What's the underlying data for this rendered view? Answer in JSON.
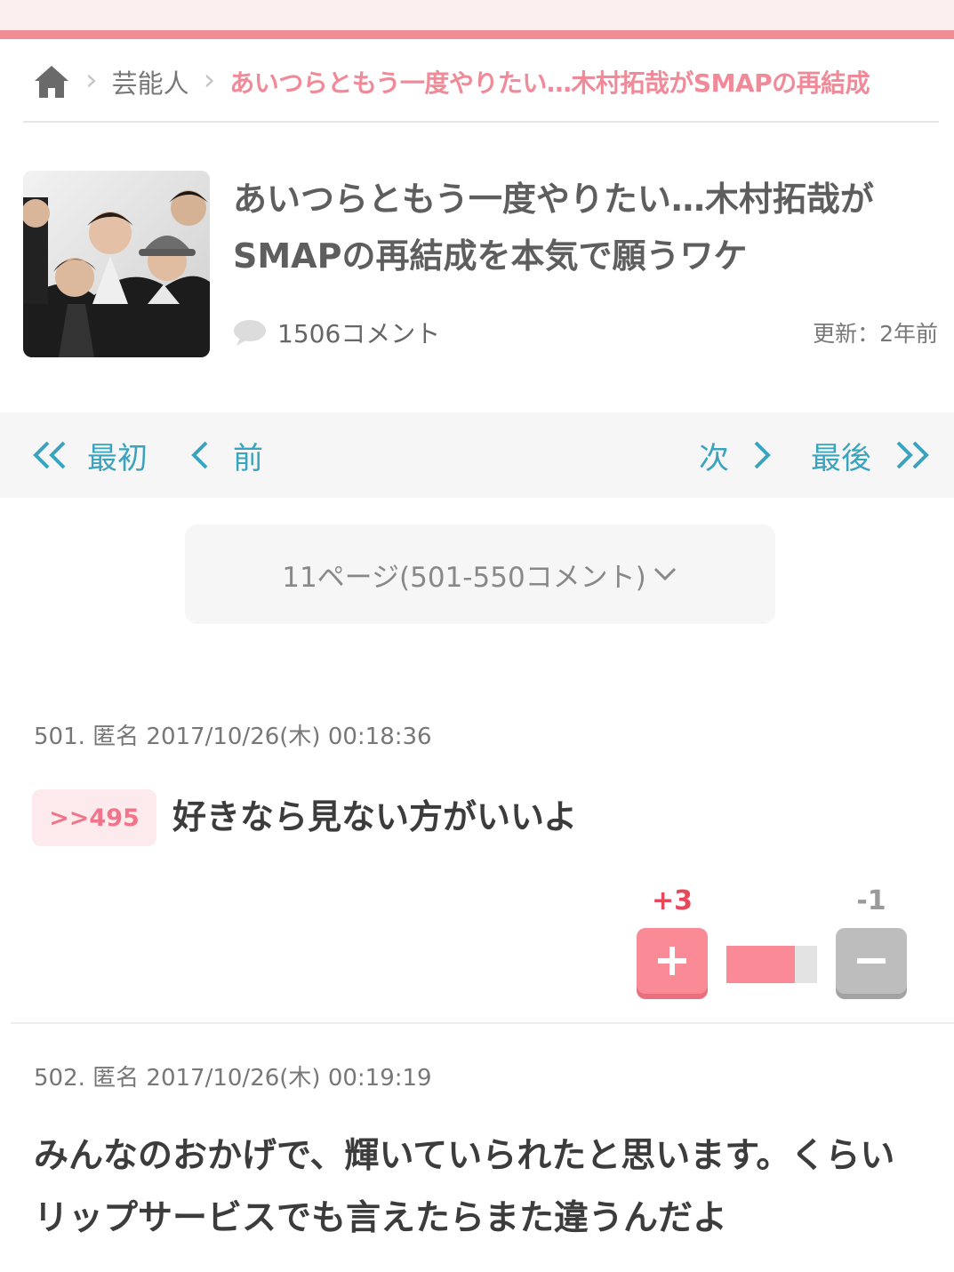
{
  "colors": {
    "accent": "#f28c94",
    "link": "#3aa3bd",
    "breadcrumb_current": "#f08a98",
    "plus": "#f98a96",
    "minus": "#bdbdbd"
  },
  "breadcrumb": {
    "home_icon": "home-icon",
    "items": [
      "芸能人"
    ],
    "current": "あいつらともう一度やりたい…木村拓哉がSMAPの再結成"
  },
  "article": {
    "title": "あいつらともう一度やりたい…木村拓哉がSMAPの再結成を本気で願うワケ",
    "comments": "1506コメント",
    "updated": "更新：2年前"
  },
  "pager": {
    "first": "最初",
    "prev": "前",
    "next": "次",
    "last": "最後"
  },
  "page_select": {
    "label": "11ページ(501-550コメント)"
  },
  "comments": [
    {
      "header": "501. 匿名 2017/10/26(木) 00:18:36",
      "anchor": ">>495",
      "body": "好きなら見ない方がいいよ",
      "plus": "+3",
      "minus": "-1",
      "plus_ratio": 0.75
    },
    {
      "header": "502. 匿名 2017/10/26(木) 00:19:19",
      "body": "みんなのおかげで、輝いていられたと思います。くらいリップサービスでも言えたらまた違うんだよ"
    }
  ]
}
